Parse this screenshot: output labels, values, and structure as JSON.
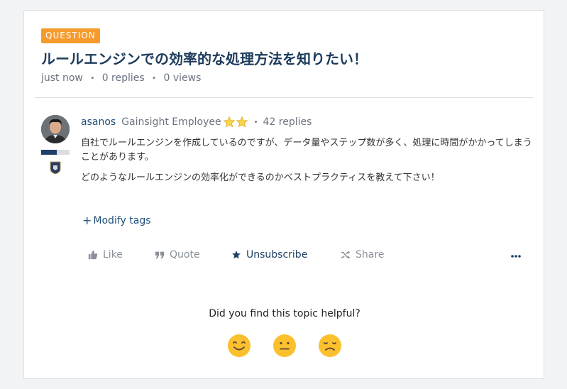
{
  "topic": {
    "badge": "QUESTION",
    "title": "ルールエンジンでの効率的な処理方法を知りたい！",
    "meta": {
      "time": "just now",
      "replies": "0 replies",
      "views": "0 views"
    }
  },
  "post": {
    "author": "asanos",
    "role": "Gainsight Employee",
    "reply_count": "42 replies",
    "rank_progress": 0.55,
    "body": [
      "自社でルールエンジンを作成しているのですが、データ量やステップ数が多く、処理に時間がかかってしまうことがあります。",
      "どのようなルールエンジンの効率化ができるのかベストプラクティスを教えて下さい！"
    ],
    "modify_tags": "Modify tags"
  },
  "actions": {
    "like": "Like",
    "quote": "Quote",
    "unsubscribe": "Unsubscribe",
    "share": "Share"
  },
  "feedback": {
    "question": "Did you find this topic helpful?"
  },
  "colors": {
    "badge": "#f59a2c",
    "title": "#1d3b5c",
    "link": "#1f4e79",
    "muted": "#8a9099",
    "rank": "#1f3f66"
  }
}
